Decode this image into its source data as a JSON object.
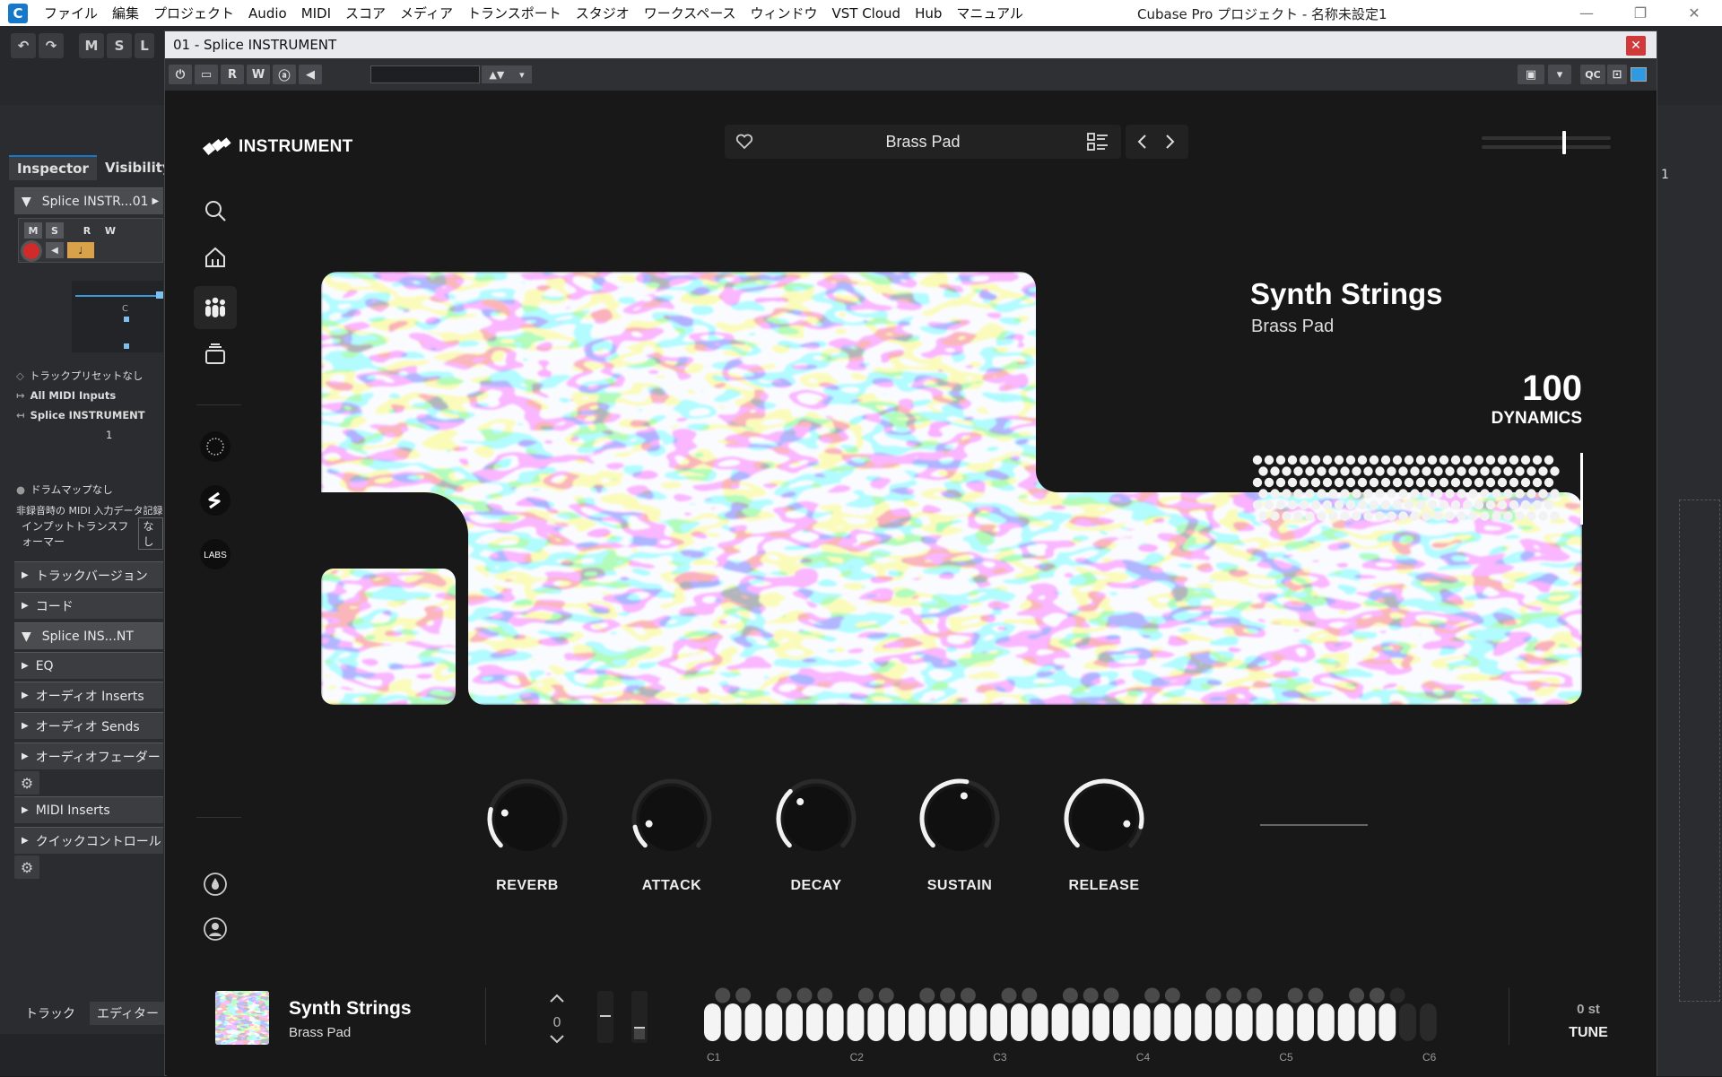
{
  "menubar": {
    "items": [
      "ファイル",
      "編集",
      "プロジェクト",
      "Audio",
      "MIDI",
      "スコア",
      "メディア",
      "トランスポート",
      "スタジオ",
      "ワークスペース",
      "ウィンドウ",
      "VST Cloud",
      "Hub",
      "マニュアル"
    ],
    "window_title": "Cubase Pro プロジェクト - 名称未設定1"
  },
  "toolbar": {
    "m_label": "M",
    "s_label": "S",
    "l_label": "L"
  },
  "inspector": {
    "tabs": [
      "Inspector",
      "Visibility"
    ],
    "track_name": "Splice INSTR...01",
    "buttons": [
      "M",
      "S",
      "R",
      "W"
    ],
    "small_c": "C",
    "rows": [
      "トラックプリセットなし",
      "All MIDI Inputs",
      "Splice INSTRUMENT"
    ],
    "channel_num": "1",
    "drum_map": "ドラムマップなし",
    "midi_record": "非録音時の MIDI 入力データ記録",
    "input_transformer": "インプットトランスフォーマー",
    "input_transformer_val": "なし",
    "sections_a": [
      "トラックバージョン",
      "コード"
    ],
    "instrument_section": "Splice INS...NT",
    "sections_b": [
      "EQ",
      "オーディオ Inserts",
      "オーディオ Sends",
      "オーディオフェーダー"
    ],
    "sections_c": [
      "MIDI Inserts",
      "クイックコントロール"
    ],
    "bottom_tabs": [
      "トラック",
      "エディター"
    ]
  },
  "right_panel": {
    "value": "1"
  },
  "plugin": {
    "title": "01 - Splice INSTRUMENT",
    "toolbar_buttons": [
      "R",
      "W"
    ],
    "qc_label": "QC"
  },
  "instrument": {
    "logo_text": "INSTRUMENT",
    "preset_name": "Brass Pad",
    "title": "Synth Strings",
    "subtitle": "Brass Pad",
    "dynamics_value": "100",
    "dynamics_label": "DYNAMICS",
    "volume_level": 0.64,
    "labs_label": "LABS",
    "knobs": [
      {
        "label": "REVERB",
        "value": 0.22
      },
      {
        "label": "ATTACK",
        "value": 0.12
      },
      {
        "label": "DECAY",
        "value": 0.34
      },
      {
        "label": "SUSTAIN",
        "value": 0.54
      },
      {
        "label": "RELEASE",
        "value": 0.88
      }
    ]
  },
  "bottom": {
    "title": "Synth Strings",
    "subtitle": "Brass Pad",
    "octave": "0",
    "tune_value": "0 st",
    "tune_label": "TUNE",
    "octave_labels": [
      "C1",
      "C2",
      "C3",
      "C4",
      "C5",
      "C6"
    ]
  },
  "colors": {
    "accent": "#1778c9",
    "close": "#d13a3a",
    "bg": "#181818"
  }
}
